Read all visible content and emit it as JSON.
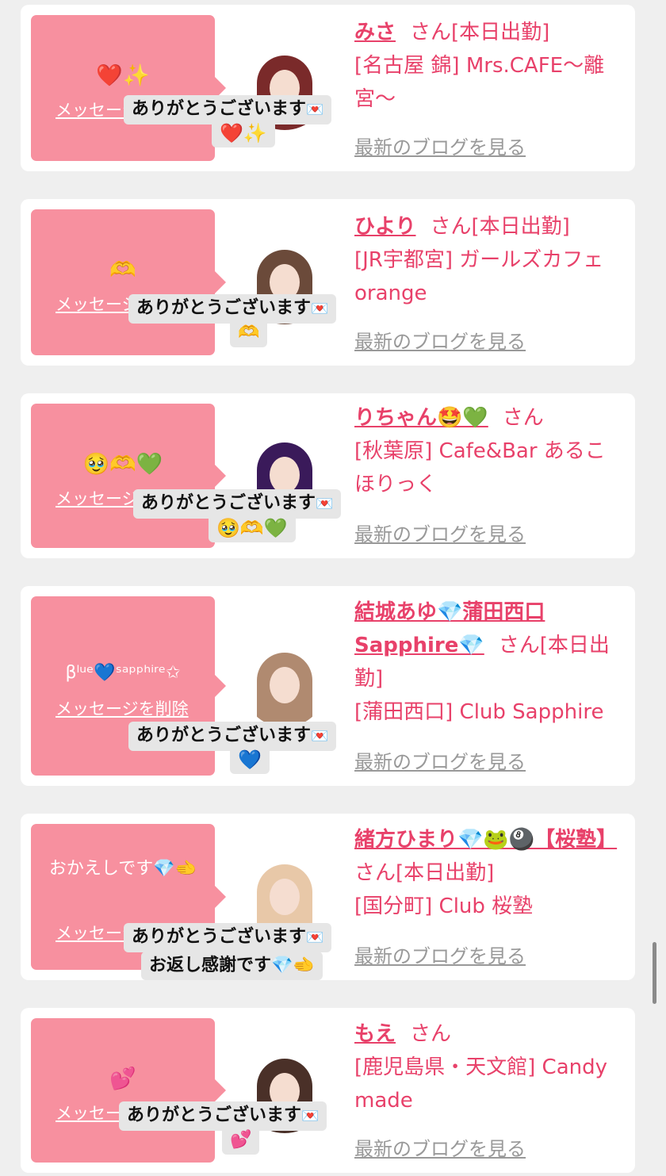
{
  "delete_label": "メッセージを削除",
  "blog_label": "最新のブログを見る",
  "thanks_text": "ありがとうございます",
  "envelope_icon": "💌",
  "cards": [
    {
      "name": "みさ",
      "san": "さん[本日出勤]",
      "shop": "[名古屋 錦] Mrs.CAFE〜離宮〜",
      "bubble_text": "❤️✨",
      "reply": "❤️✨",
      "avatar_colors": [
        "#7a2a2a",
        "#c9a27a"
      ]
    },
    {
      "name": "ひより",
      "san": "さん[本日出勤]",
      "shop": "[JR宇都宮] ガールズカフェorange",
      "bubble_text": "🫶",
      "reply": "🫶",
      "avatar_colors": [
        "#c8c8c8",
        "#6b4a3a"
      ]
    },
    {
      "name": "りちゃん🤩💚",
      "san": "さん",
      "shop": "[秋葉原] Cafe&Bar あるこほりっく",
      "bubble_text": "🥹🫶💚",
      "reply": "🥹🫶💚",
      "avatar_colors": [
        "#3a1a5a",
        "#2a2a2a"
      ]
    },
    {
      "name": "結城あゆ💎蒲田西口Sapphire💎",
      "san": "さん[本日出勤]",
      "shop": "[蒲田西口] Club Sapphire",
      "bubble_text": "βˡᵘᵉ💙ˢᵃᵖᵖʰⁱʳᵉ✩",
      "reply": "💙",
      "avatar_colors": [
        "#f0d0d0",
        "#b08a70"
      ]
    },
    {
      "name": "緒方ひまり💎🐸🎱【桜塾】",
      "san": "さん[本日出勤]",
      "shop": "[国分町] Club 桜塾",
      "bubble_text": "おかえしです💎🫲",
      "reply": "お返し感謝です💎🫲",
      "avatar_colors": [
        "#d8d8e8",
        "#e8c8a8"
      ]
    },
    {
      "name": "もえ",
      "san": "さん",
      "shop": "[鹿児島県・天文館] Candy made",
      "bubble_text": "💕",
      "reply": "💕",
      "avatar_colors": [
        "#f5e0e8",
        "#4a3028"
      ]
    }
  ]
}
